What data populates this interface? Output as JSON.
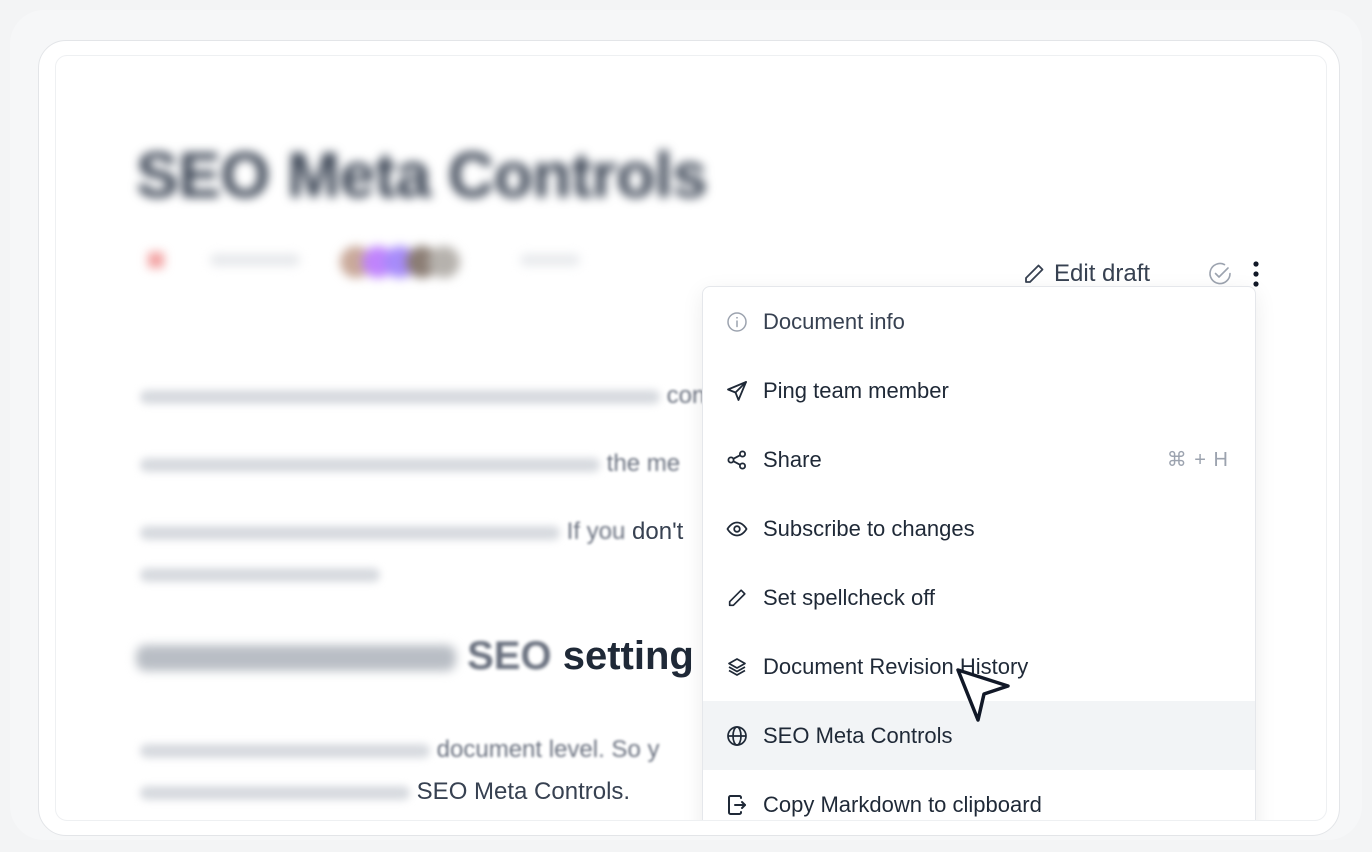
{
  "document": {
    "title": "SEO Meta Controls",
    "para1_tail": "control",
    "para2_tail": "the me",
    "para3_tail1": "If you",
    "para3_tail2": "don't",
    "heading_tail1": "SEO",
    "heading_tail2": "setting",
    "para4_tail": "document level. So y",
    "para5_tail": "SEO Meta Controls."
  },
  "toolbar": {
    "edit_draft_label": "Edit draft",
    "edit_icon": "pencil-icon",
    "status_icon": "check-circle-icon",
    "more_icon": "kebab-icon"
  },
  "menu": {
    "items": [
      {
        "label": "Document info",
        "icon": "info-icon",
        "shortcut": ""
      },
      {
        "label": "Ping team member",
        "icon": "send-icon",
        "shortcut": ""
      },
      {
        "label": "Share",
        "icon": "share-icon",
        "shortcut": "⌘ + H"
      },
      {
        "label": "Subscribe to changes",
        "icon": "eye-icon",
        "shortcut": ""
      },
      {
        "label": "Set spellcheck off",
        "icon": "pencil-icon",
        "shortcut": ""
      },
      {
        "label": "Document Revision History",
        "icon": "layers-icon",
        "shortcut": ""
      },
      {
        "label": "SEO Meta Controls",
        "icon": "globe-icon",
        "shortcut": "",
        "active": true
      },
      {
        "label": "Copy Markdown to clipboard",
        "icon": "copy-icon",
        "shortcut": ""
      }
    ]
  },
  "colors": {
    "menu_hover": "#f2f4f6",
    "text": "#1f2937",
    "muted": "#9ca3af"
  }
}
